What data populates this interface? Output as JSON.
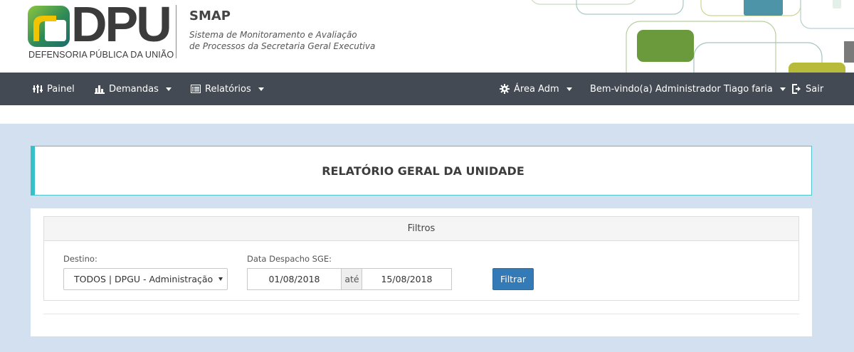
{
  "header": {
    "logo_text": "DPU",
    "logo_subtitle": "DEFENSORIA PÚBLICA DA UNIÃO",
    "app_name": "SMAP",
    "app_description_line1": "Sistema de Monitoramento e Avaliação",
    "app_description_line2": "de Processos da Secretaria Geral Executiva",
    "decor_colors": [
      "#6a9a3c",
      "#4e94a8",
      "#b8bb3a"
    ]
  },
  "navbar": {
    "background": "#434a54",
    "items": [
      {
        "label": "Painel",
        "icon": "sliders-icon"
      },
      {
        "label": "Demandas",
        "icon": "bar-chart-icon",
        "dropdown": true
      },
      {
        "label": "Relatórios",
        "icon": "list-alt-icon",
        "dropdown": true
      },
      {
        "label": "Área Adm",
        "icon": "gear-icon",
        "dropdown": true
      },
      {
        "label": "Bem-vindo(a) Administrador Tiago faria",
        "dropdown": true
      },
      {
        "label": "Sair",
        "icon": "sign-out-icon"
      }
    ]
  },
  "page": {
    "title": "RELATÓRIO GERAL DA UNIDADE",
    "accent_color": "#36c0c9",
    "background": "#d3e0ef"
  },
  "filters": {
    "panel_title": "Filtros",
    "destino_label": "Destino:",
    "destino_value": "TODOS | DPGU - Administração",
    "date_label": "Data Despacho SGE:",
    "date_from": "01/08/2018",
    "date_sep": "até",
    "date_to": "15/08/2018",
    "filter_button": "Filtrar",
    "button_color": "#337ab7"
  }
}
